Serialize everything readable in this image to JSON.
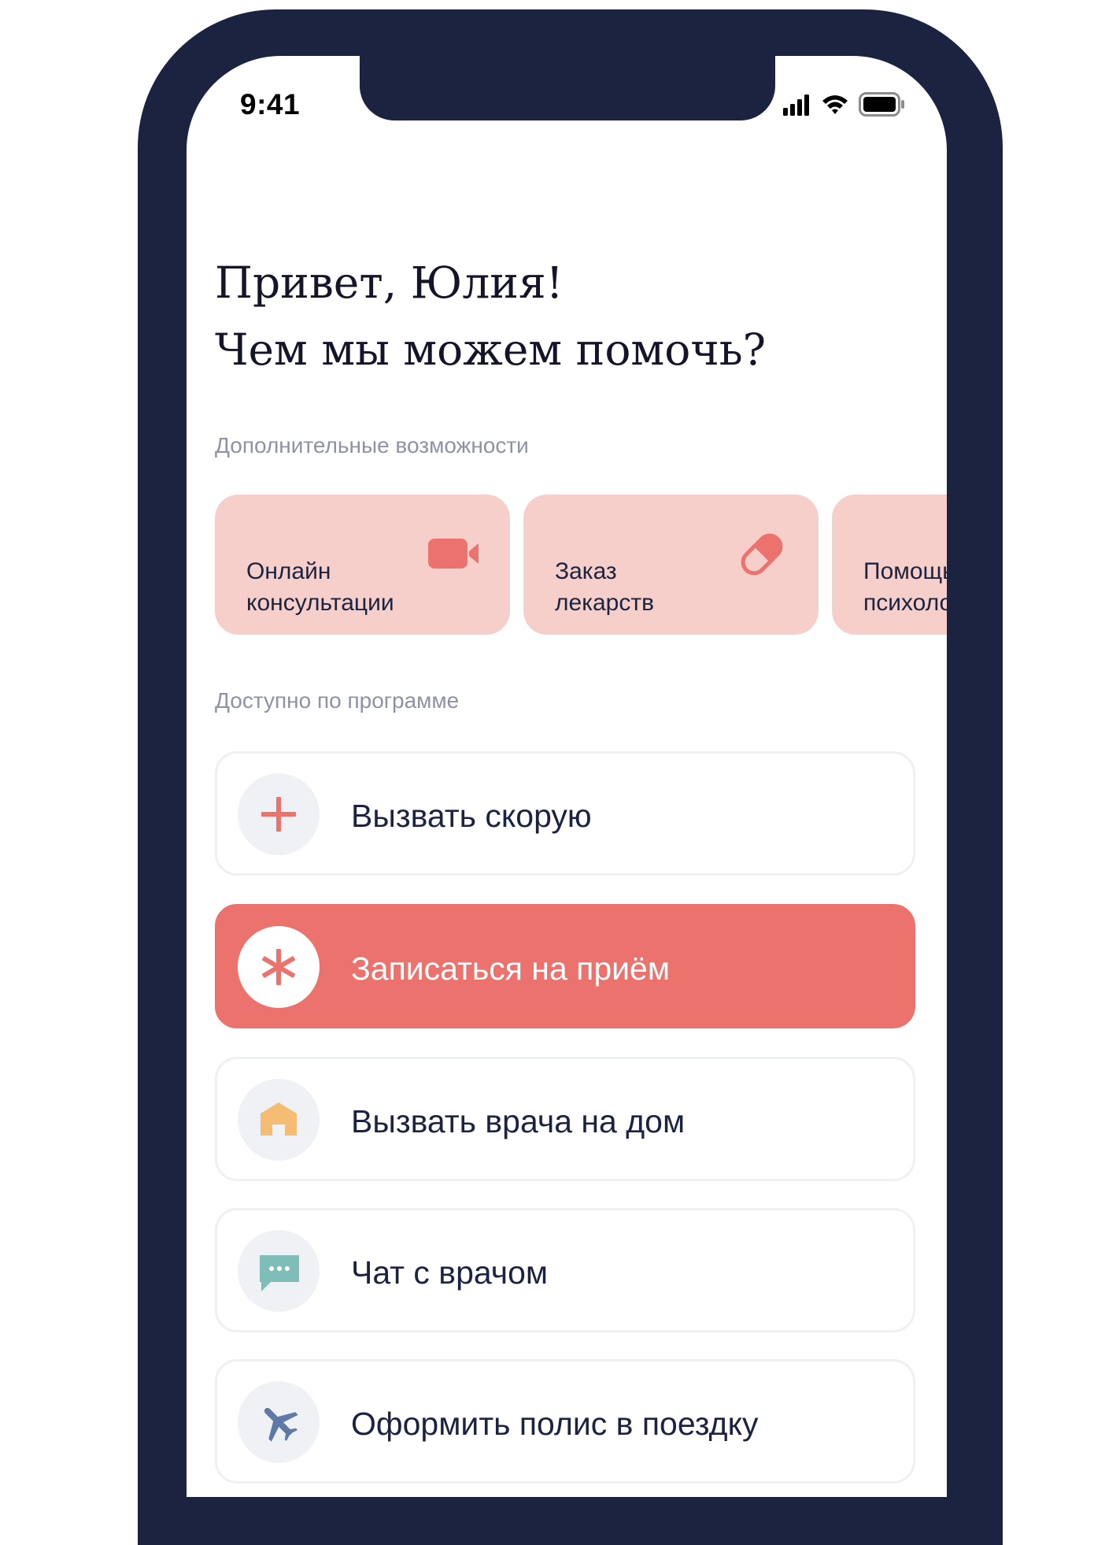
{
  "status_bar": {
    "time": "9:41",
    "icons": [
      "cellular-signal-icon",
      "wifi-icon",
      "battery-icon"
    ]
  },
  "greeting": {
    "line1": "Привет, Юлия!",
    "line2": "Чем мы можем помочь?"
  },
  "extra": {
    "title": "Дополнительные возможности",
    "items": [
      {
        "label": "Онлайн\nконсультации",
        "icon": "video-camera-icon"
      },
      {
        "label": "Заказ\nлекарств",
        "icon": "pill-icon"
      },
      {
        "label": "Помощь\nпсихолога",
        "icon": ""
      }
    ]
  },
  "program": {
    "title": "Доступно по программе",
    "items": [
      {
        "label": "Вызвать скорую",
        "icon": "plus-icon",
        "active": false
      },
      {
        "label": "Записаться на приём",
        "icon": "asterisk-icon",
        "active": true
      },
      {
        "label": "Вызвать врача на дом",
        "icon": "house-icon",
        "active": false
      },
      {
        "label": "Чат с врачом",
        "icon": "chat-bubble-icon",
        "active": false
      },
      {
        "label": "Оформить полис в поездку",
        "icon": "airplane-icon",
        "active": false
      }
    ]
  },
  "colors": {
    "accent": "#ec726d",
    "chip_bg": "#f6cfca",
    "text_dark": "#1b2341",
    "muted": "#8d93a4",
    "frame": "#1b2341"
  }
}
